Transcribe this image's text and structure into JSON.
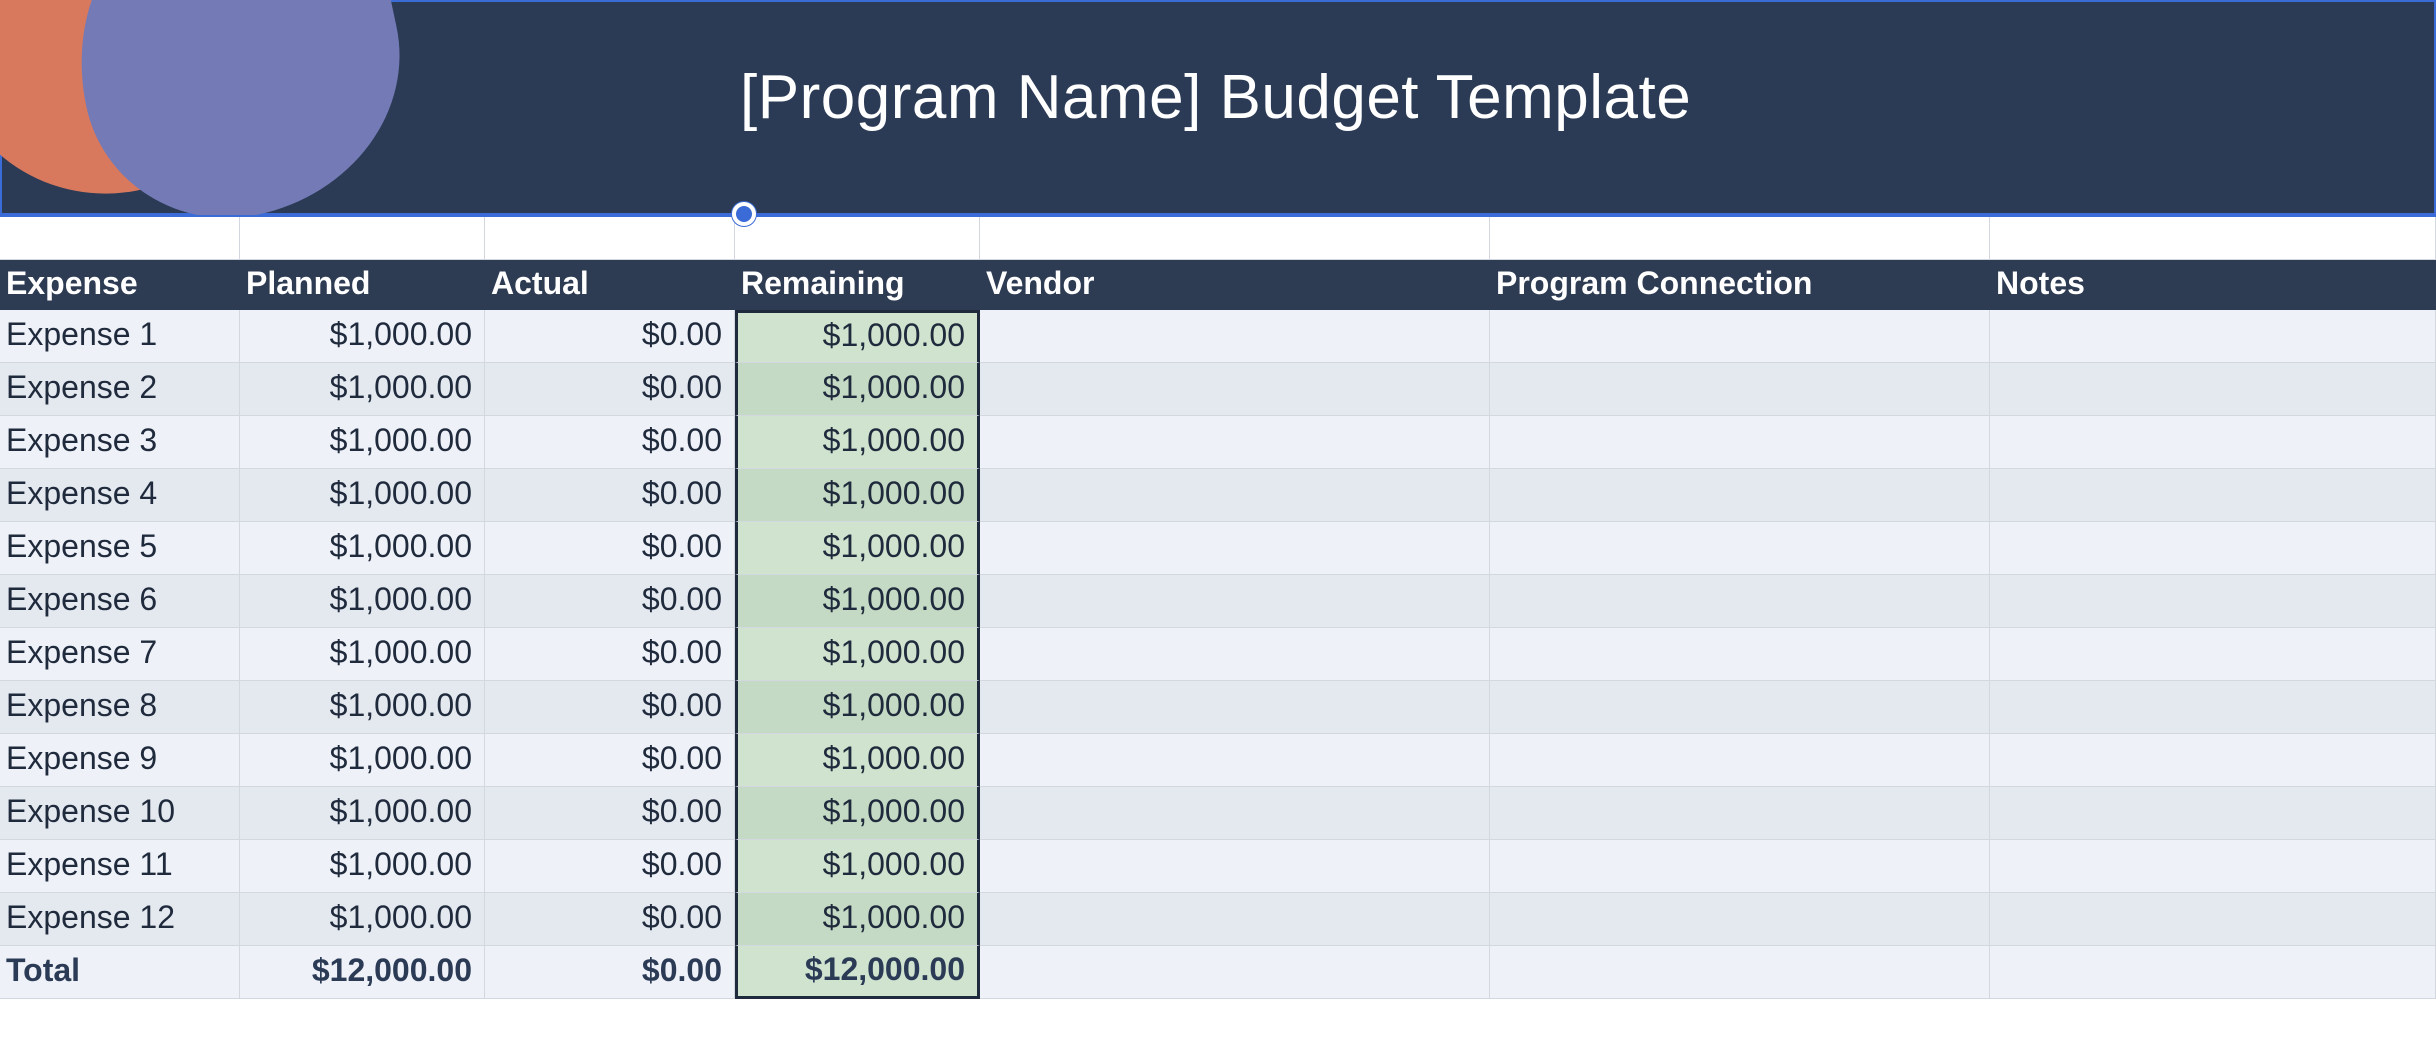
{
  "title": "[Program Name] Budget Template",
  "columns": {
    "expense": "Expense",
    "planned": "Planned",
    "actual": "Actual",
    "remaining": "Remaining",
    "vendor": "Vendor",
    "connection": "Program Connection",
    "notes": "Notes"
  },
  "rows": [
    {
      "expense": "Expense 1",
      "planned": "$1,000.00",
      "actual": "$0.00",
      "remaining": "$1,000.00",
      "vendor": "",
      "connection": "",
      "notes": ""
    },
    {
      "expense": "Expense 2",
      "planned": "$1,000.00",
      "actual": "$0.00",
      "remaining": "$1,000.00",
      "vendor": "",
      "connection": "",
      "notes": ""
    },
    {
      "expense": "Expense 3",
      "planned": "$1,000.00",
      "actual": "$0.00",
      "remaining": "$1,000.00",
      "vendor": "",
      "connection": "",
      "notes": ""
    },
    {
      "expense": "Expense 4",
      "planned": "$1,000.00",
      "actual": "$0.00",
      "remaining": "$1,000.00",
      "vendor": "",
      "connection": "",
      "notes": ""
    },
    {
      "expense": "Expense 5",
      "planned": "$1,000.00",
      "actual": "$0.00",
      "remaining": "$1,000.00",
      "vendor": "",
      "connection": "",
      "notes": ""
    },
    {
      "expense": "Expense 6",
      "planned": "$1,000.00",
      "actual": "$0.00",
      "remaining": "$1,000.00",
      "vendor": "",
      "connection": "",
      "notes": ""
    },
    {
      "expense": "Expense 7",
      "planned": "$1,000.00",
      "actual": "$0.00",
      "remaining": "$1,000.00",
      "vendor": "",
      "connection": "",
      "notes": ""
    },
    {
      "expense": "Expense 8",
      "planned": "$1,000.00",
      "actual": "$0.00",
      "remaining": "$1,000.00",
      "vendor": "",
      "connection": "",
      "notes": ""
    },
    {
      "expense": "Expense 9",
      "planned": "$1,000.00",
      "actual": "$0.00",
      "remaining": "$1,000.00",
      "vendor": "",
      "connection": "",
      "notes": ""
    },
    {
      "expense": "Expense 10",
      "planned": "$1,000.00",
      "actual": "$0.00",
      "remaining": "$1,000.00",
      "vendor": "",
      "connection": "",
      "notes": ""
    },
    {
      "expense": "Expense 11",
      "planned": "$1,000.00",
      "actual": "$0.00",
      "remaining": "$1,000.00",
      "vendor": "",
      "connection": "",
      "notes": ""
    },
    {
      "expense": "Expense 12",
      "planned": "$1,000.00",
      "actual": "$0.00",
      "remaining": "$1,000.00",
      "vendor": "",
      "connection": "",
      "notes": ""
    }
  ],
  "total": {
    "label": "Total",
    "planned": "$12,000.00",
    "actual": "$0.00",
    "remaining": "$12,000.00"
  }
}
